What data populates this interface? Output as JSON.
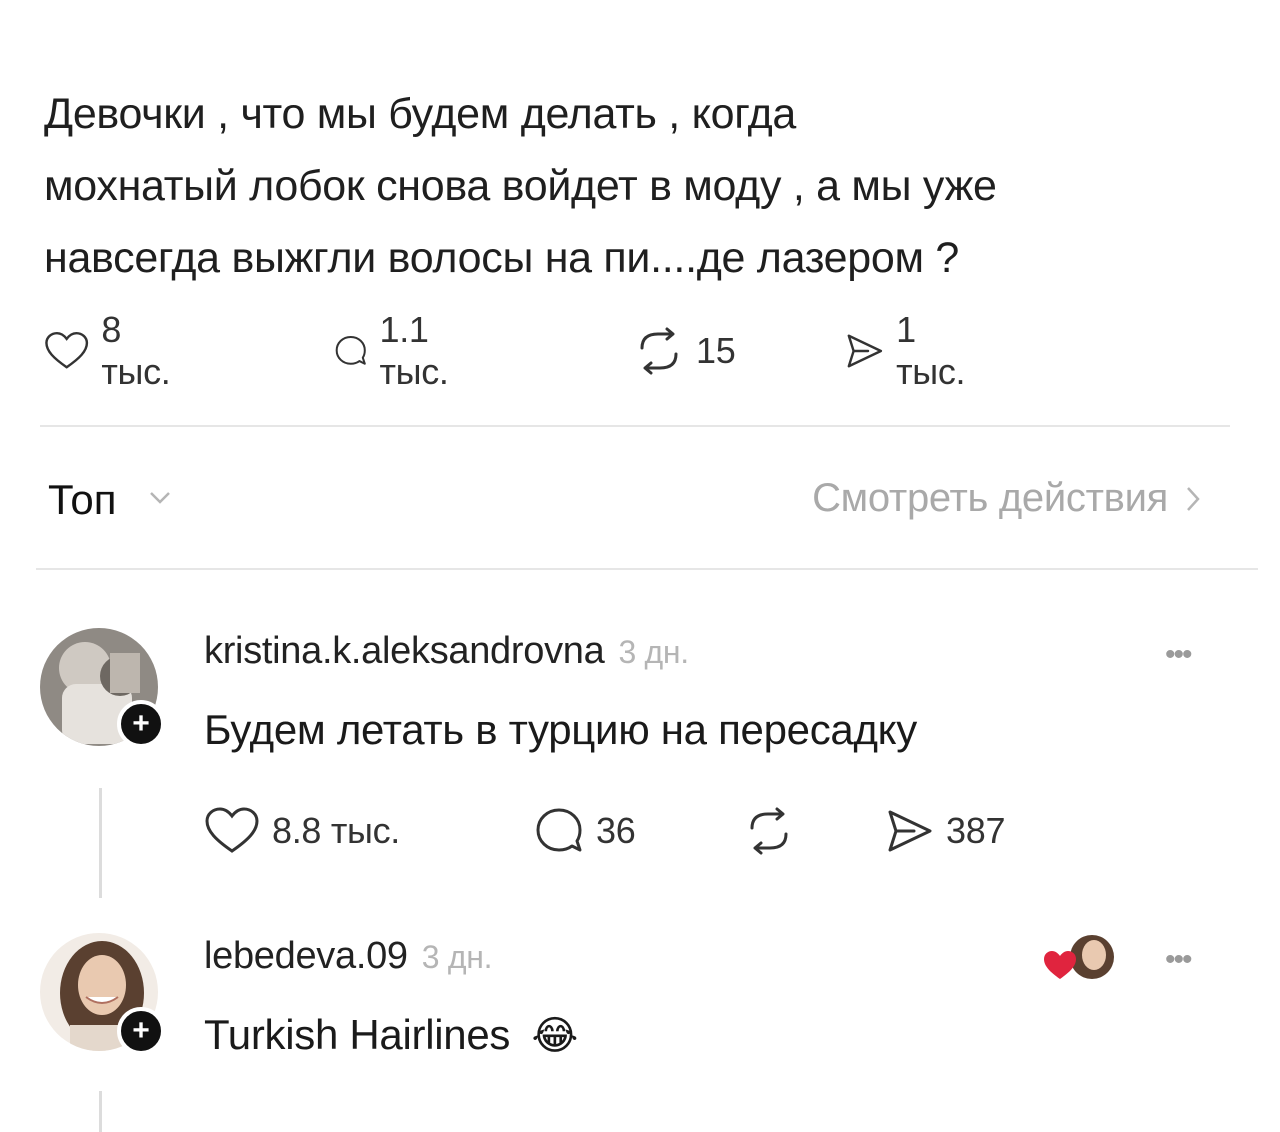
{
  "post": {
    "text_lines": [
      "Девочки , что мы будем делать , когда",
      "мохнатый лобок снова войдет в моду , а мы уже",
      "навсегда выжгли волосы на пи....де лазером ?"
    ],
    "stats": {
      "likes": "8 тыс.",
      "comments": "1.1 тыс.",
      "reposts": "15",
      "shares": "1 тыс."
    }
  },
  "sort": {
    "label": "Топ",
    "actions_link": "Смотреть действия"
  },
  "comments": [
    {
      "username": "kristina.k.aleksandrovna",
      "time": "3 дн.",
      "text": "Будем летать в турцию на пересадку",
      "stats": {
        "likes": "8.8 тыс.",
        "comments": "36",
        "reposts": "",
        "shares": "387"
      }
    },
    {
      "username": "lebedeva.09",
      "time": "3 дн.",
      "text": "Turkish Hairlines",
      "emoji": "😂"
    }
  ],
  "icons": [
    "heart-icon",
    "comment-icon",
    "repost-icon",
    "share-icon",
    "chevron-down-icon",
    "chevron-right-icon",
    "more-icon",
    "plus-icon"
  ]
}
